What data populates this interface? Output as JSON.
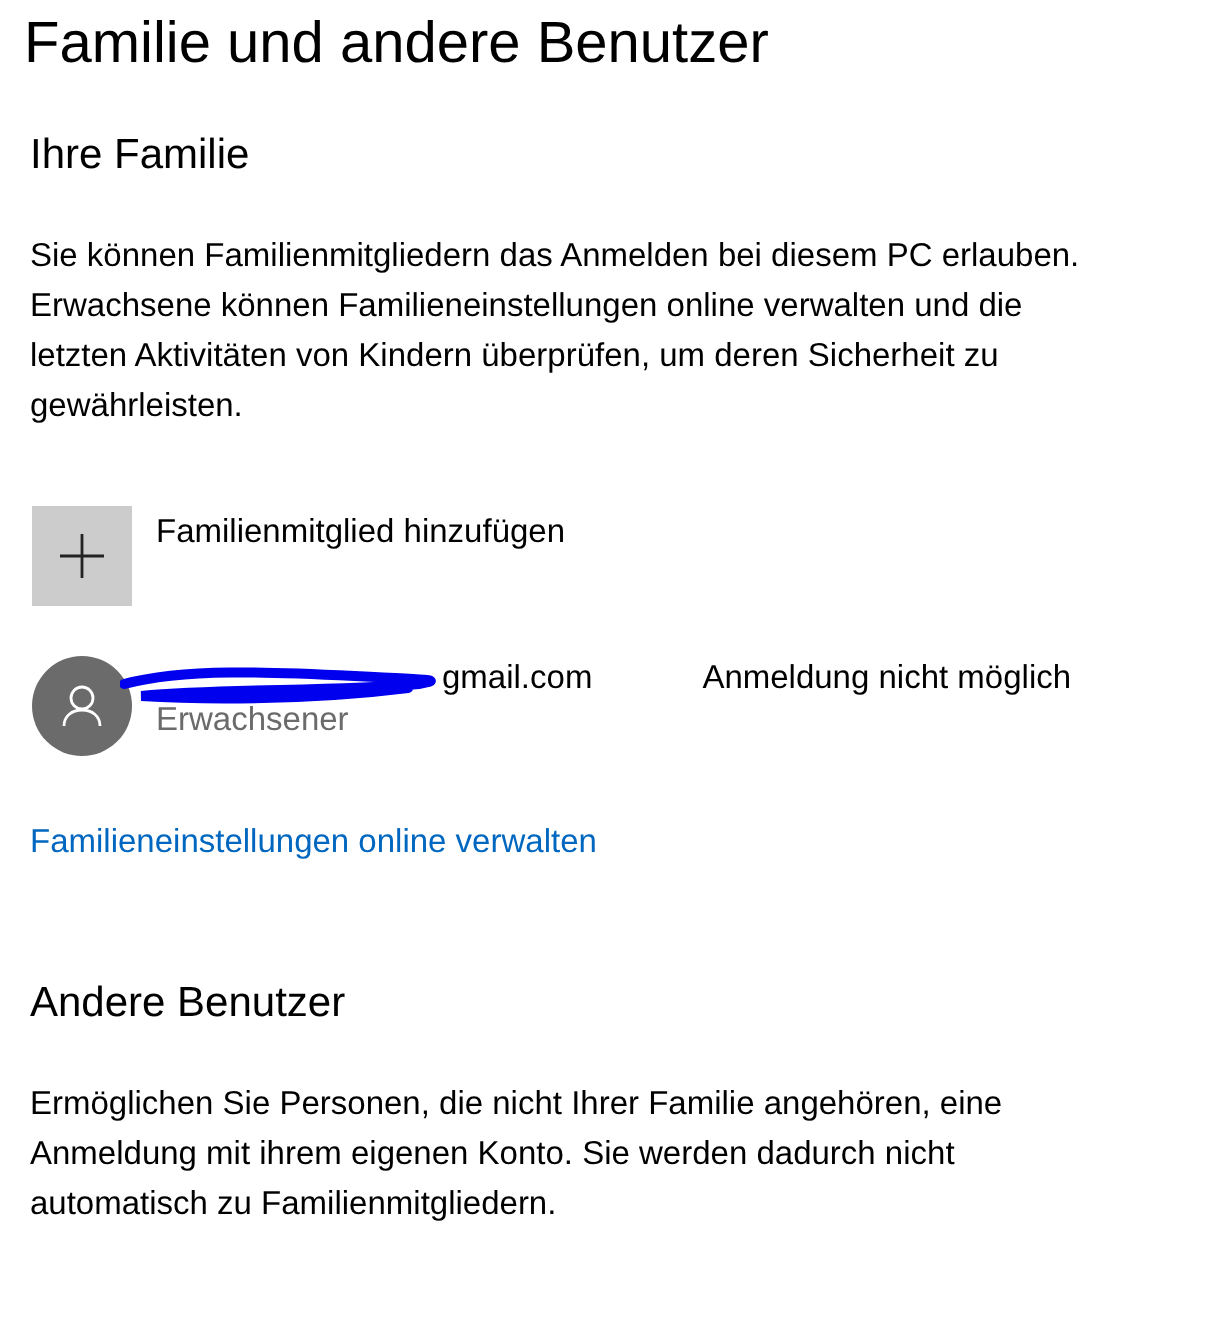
{
  "page_title": "Familie und andere Benutzer",
  "family": {
    "heading": "Ihre Familie",
    "description": "Sie können Familienmitgliedern das Anmelden bei diesem PC erlauben. Erwachsene können Familieneinstellungen online verwalten und die letzten Aktivitäten von Kindern überprüfen, um deren Sicherheit zu gewährleisten.",
    "add_label": "Familienmitglied hinzufügen",
    "members": [
      {
        "account": "gmail.com",
        "redacted": true,
        "role": "Erwachsener",
        "status": "Anmeldung nicht möglich"
      }
    ],
    "manage_link": "Familieneinstellungen online verwalten"
  },
  "other_users": {
    "heading": "Andere Benutzer",
    "description": "Ermöglichen Sie Personen, die nicht Ihrer Familie angehören, eine Anmeldung mit ihrem eigenen Konto. Sie werden dadurch nicht automatisch zu Familienmitgliedern."
  }
}
